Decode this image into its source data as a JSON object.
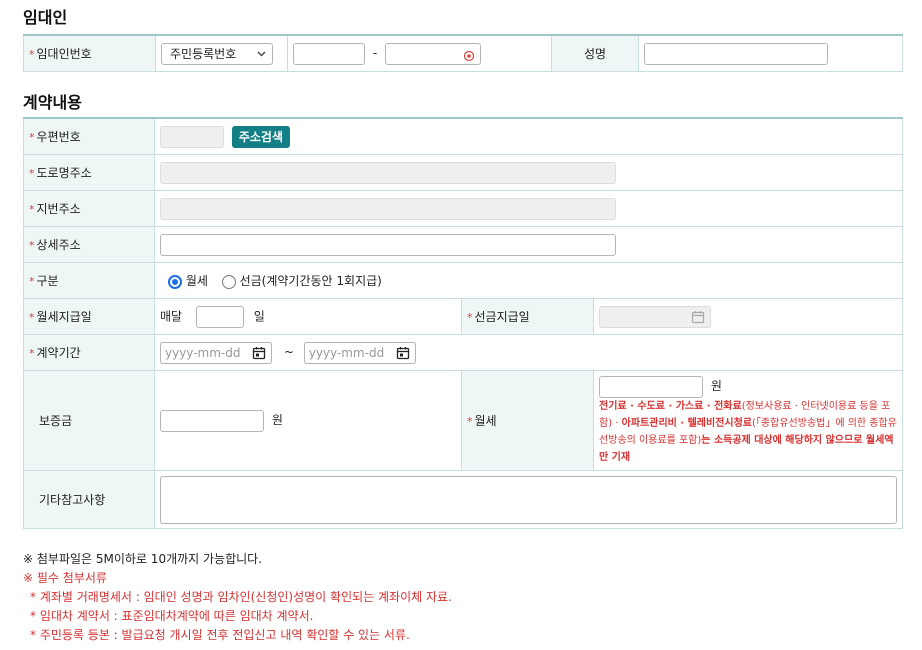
{
  "landlord": {
    "section_title": "임대인",
    "id_label": "임대인번호",
    "id_type_value": "주민등록번호",
    "dash": "-",
    "name_label": "성명"
  },
  "contract": {
    "section_title": "계약내용",
    "postal_label": "우편번호",
    "address_search_button": "주소검색",
    "road_address_label": "도로명주소",
    "lot_address_label": "지번주소",
    "detail_address_label": "상세주소",
    "type_label": "구분",
    "type_option_monthly": "월세",
    "type_option_prepaid": "선금(계약기간동안 1회지급)",
    "monthly_pay_label": "월세지급일",
    "monthly_prefix": "매달",
    "monthly_suffix": "일",
    "prepaid_date_label": "선금지급일",
    "period_label": "계약기간",
    "date_placeholder": "yyyy-mm-dd",
    "tilde": "~",
    "deposit_label": "보증금",
    "won": "원",
    "rent_label": "월세",
    "rent_note_p1": "전기료 · 수도료 · 가스료 · 전화료",
    "rent_note_p2": "(정보사용료 · 인터넷이용료 등을 포함) · ",
    "rent_note_p3": "아파트관리비 · 텔레비전시청료",
    "rent_note_p4": "(「종합유선방송법」에 의한 종합유선방송의 이용료를 포함)",
    "rent_note_p5": "는 소득공제 대상에 해당하지 않으므로 월세액만 기재",
    "etc_label": "기타참고사항"
  },
  "notes": {
    "attach_limit": "※ 첨부파일은 5M이하로 10개까지 가능합니다.",
    "required_title": "※ 필수 첨부서류",
    "item1": "* 계좌별 거래명세서 : 임대인 성명과 임차인(신청인)성명이 확인되는 계좌이체 자료.",
    "item2": "* 임대차 계약서 : 표준임대차계약에 따른 임대차 계약서.",
    "item3": "* 주민등록 등본 : 발급요청 개시일 전후 전입신고 내역 확인할 수 있는 서류."
  },
  "required_mark": "*",
  "colors": {
    "accent": "#127f86",
    "label_bg": "#eef6f6",
    "required": "#e03b3b",
    "radio": "#1a6ee8"
  }
}
